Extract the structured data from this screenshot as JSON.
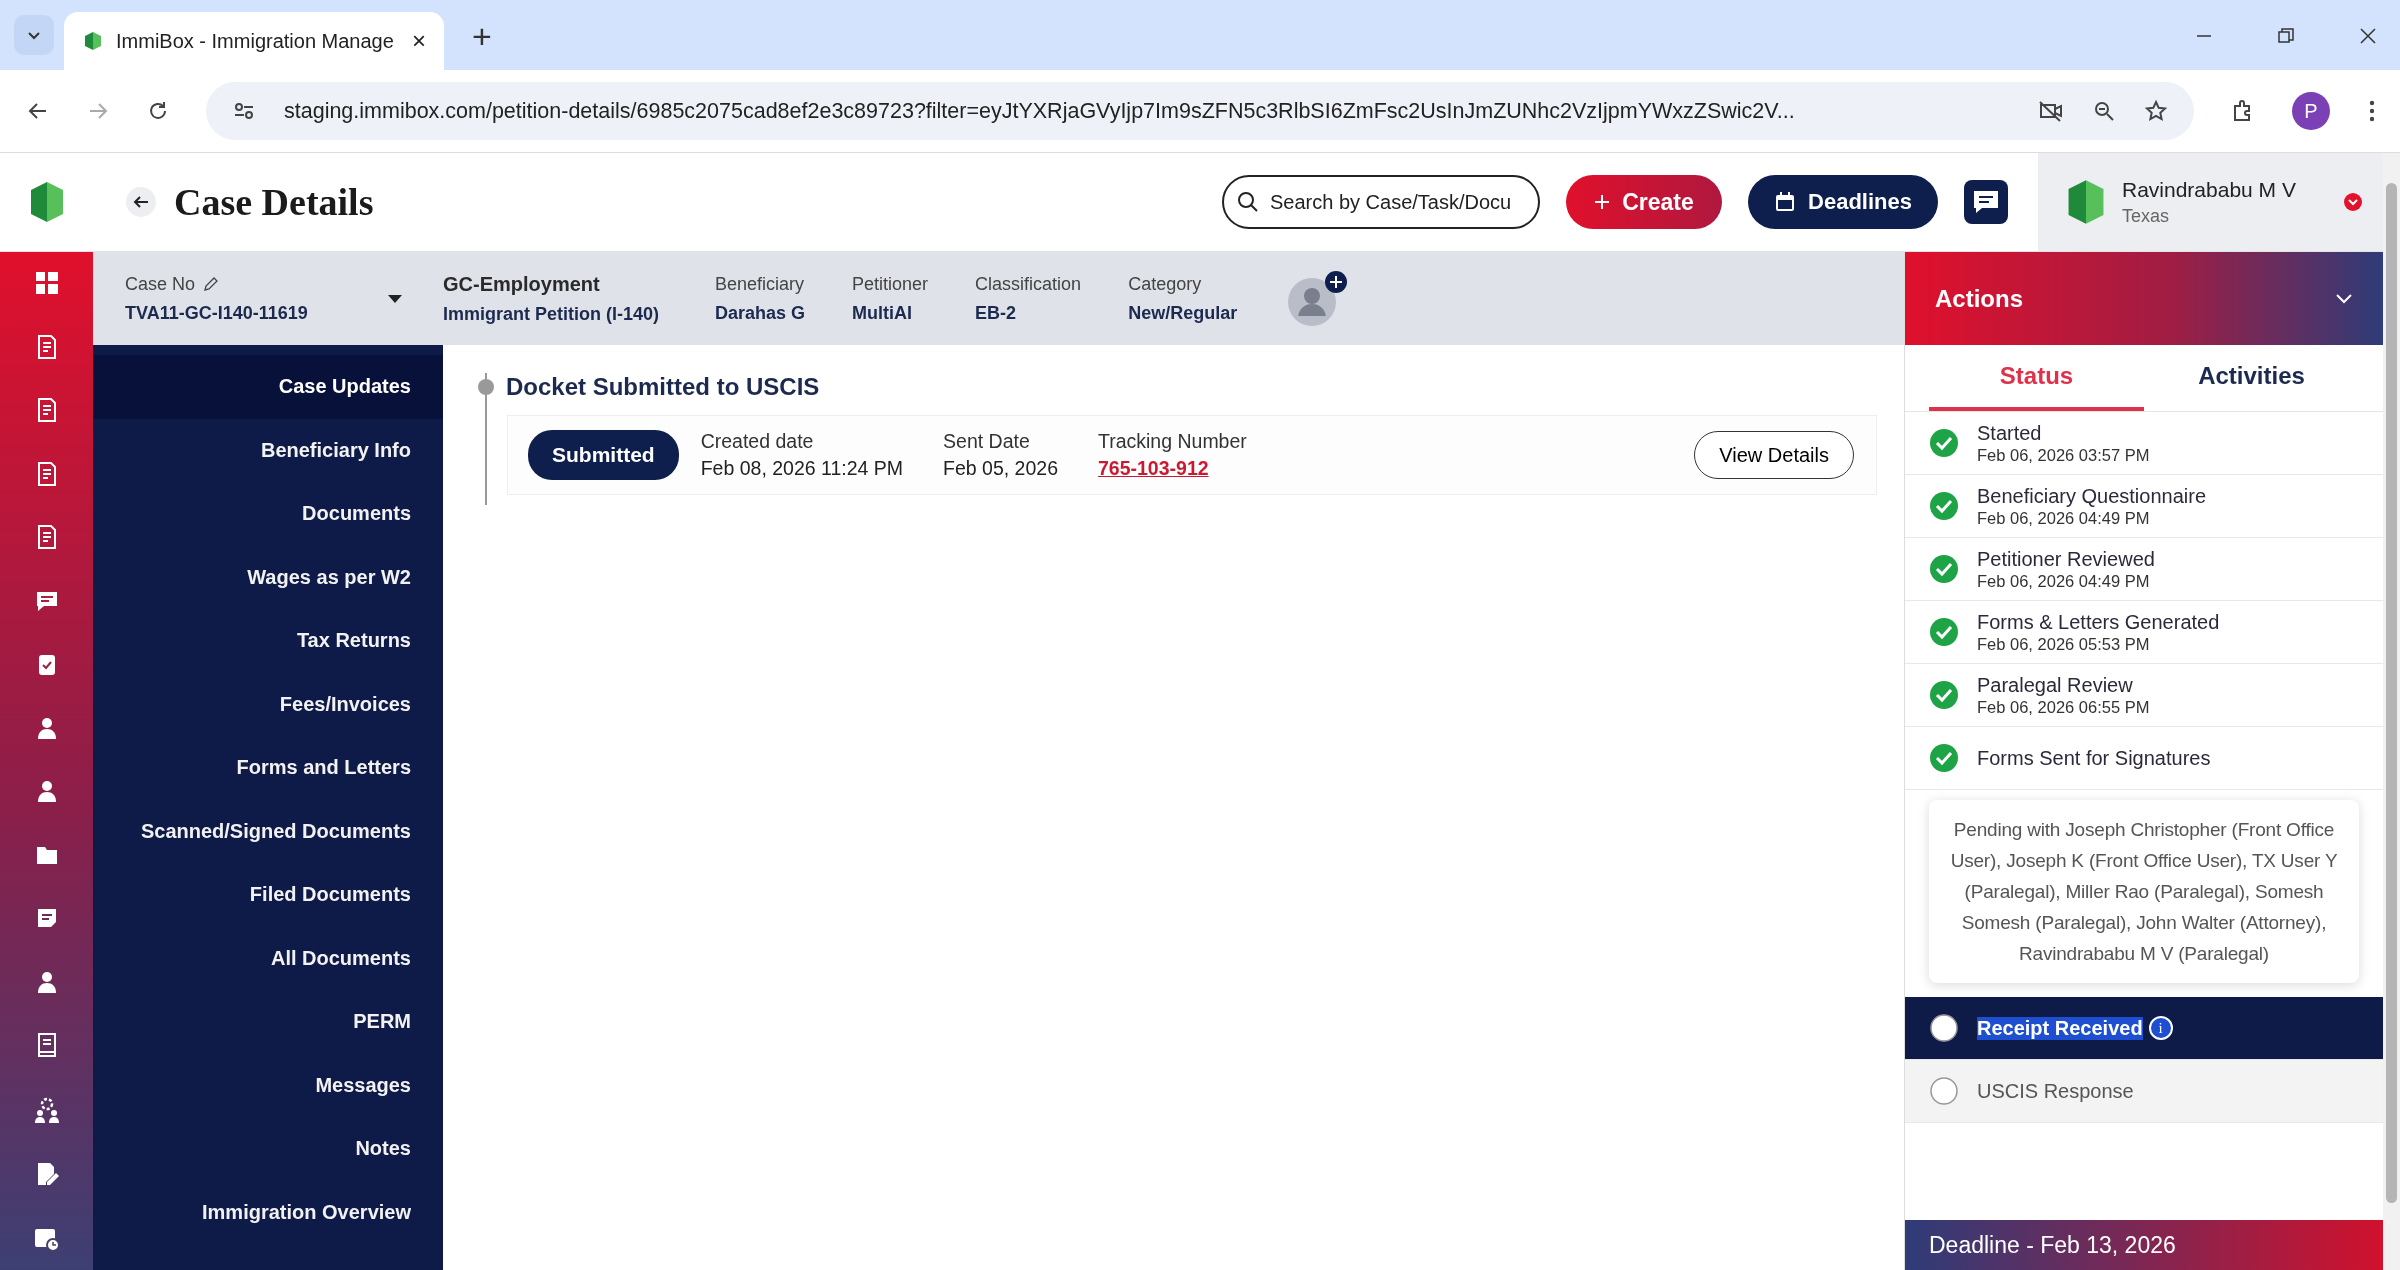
{
  "browser": {
    "tab_title": "ImmiBox - Immigration Manage",
    "tab_close": "×",
    "new_tab": "+",
    "url": "staging.immibox.com/petition-details/6985c2075cad8ef2e3c89723?filter=eyJtYXRjaGVyIjp7Im9sZFN5c3RlbSI6ZmFsc2UsInJmZUNhc2VzIjpmYWxzZSwic2V...",
    "profile": "P"
  },
  "header": {
    "title": "Case Details",
    "search": {
      "placeholder": "Search by Case/Task/Docu"
    },
    "create_button": "Create",
    "deadlines_button": "Deadlines",
    "user": {
      "name": "Ravindrababu M V",
      "location": "Texas"
    }
  },
  "case_info": {
    "case_no_label": "Case No",
    "case_no": "TVA11-GC-I140-11619",
    "case_type": "GC-Employment",
    "petition": "Immigrant Petition (I-140)",
    "fields": [
      {
        "label": "Beneficiary",
        "value": "Darahas G"
      },
      {
        "label": "Petitioner",
        "value": "MultiAI"
      },
      {
        "label": "Classification",
        "value": "EB-2"
      },
      {
        "label": "Category",
        "value": "New/Regular"
      }
    ]
  },
  "sidebar": {
    "items": [
      {
        "label": "Case Updates",
        "selected": true
      },
      {
        "label": "Beneficiary Info",
        "selected": false
      },
      {
        "label": "Documents",
        "selected": false
      },
      {
        "label": "Wages as per W2",
        "selected": false
      },
      {
        "label": "Tax Returns",
        "selected": false
      },
      {
        "label": "Fees/Invoices",
        "selected": false
      },
      {
        "label": "Forms and Letters",
        "selected": false
      },
      {
        "label": "Scanned/Signed Documents",
        "selected": false
      },
      {
        "label": "Filed Documents",
        "selected": false
      },
      {
        "label": "All Documents",
        "selected": false
      },
      {
        "label": "PERM",
        "selected": false
      },
      {
        "label": "Messages",
        "selected": false
      },
      {
        "label": "Notes",
        "selected": false
      },
      {
        "label": "Immigration Overview",
        "selected": false
      }
    ]
  },
  "docket": {
    "title": "Docket Submitted to USCIS",
    "status": "Submitted",
    "created_label": "Created date",
    "created": "Feb 08, 2026 11:24 PM",
    "sent_label": "Sent Date",
    "sent": "Feb 05, 2026",
    "tracking_label": "Tracking Number",
    "tracking": "765-103-912",
    "button": "View Details"
  },
  "actions": {
    "title": "Actions",
    "tabs": [
      {
        "label": "Status",
        "selected": true
      },
      {
        "label": "Activities",
        "selected": false
      }
    ],
    "statuses": [
      {
        "label": "Started",
        "date": "Feb 06, 2026 03:57 PM",
        "done": true,
        "selected": false
      },
      {
        "label": "Beneficiary Questionnaire",
        "date": "Feb 06, 2026 04:49 PM",
        "done": true,
        "selected": false
      },
      {
        "label": "Petitioner Reviewed",
        "date": "Feb 06, 2026 04:49 PM",
        "done": true,
        "selected": false
      },
      {
        "label": "Forms & Letters Generated",
        "date": "Feb 06, 2026 05:53 PM",
        "done": true,
        "selected": false
      },
      {
        "label": "Paralegal Review",
        "date": "Feb 06, 2026 06:55 PM",
        "done": true,
        "selected": false
      },
      {
        "label": "Forms Sent for Signatures",
        "done": true,
        "selected": false,
        "tooltip": "Pending with Joseph Christopher (Front Office User), Joseph K (Front Office User), TX User Y (Paralegal), Miller Rao (Paralegal), Somesh Somesh (Paralegal), John Walter (Attorney), Ravindrababu M V (Paralegal)"
      },
      {
        "label": "Receipt Received",
        "done": false,
        "selected": true,
        "info": "i"
      },
      {
        "label": "USCIS Response",
        "done": false,
        "selected": false
      }
    ],
    "deadline": "Deadline - Feb 13, 2026"
  }
}
